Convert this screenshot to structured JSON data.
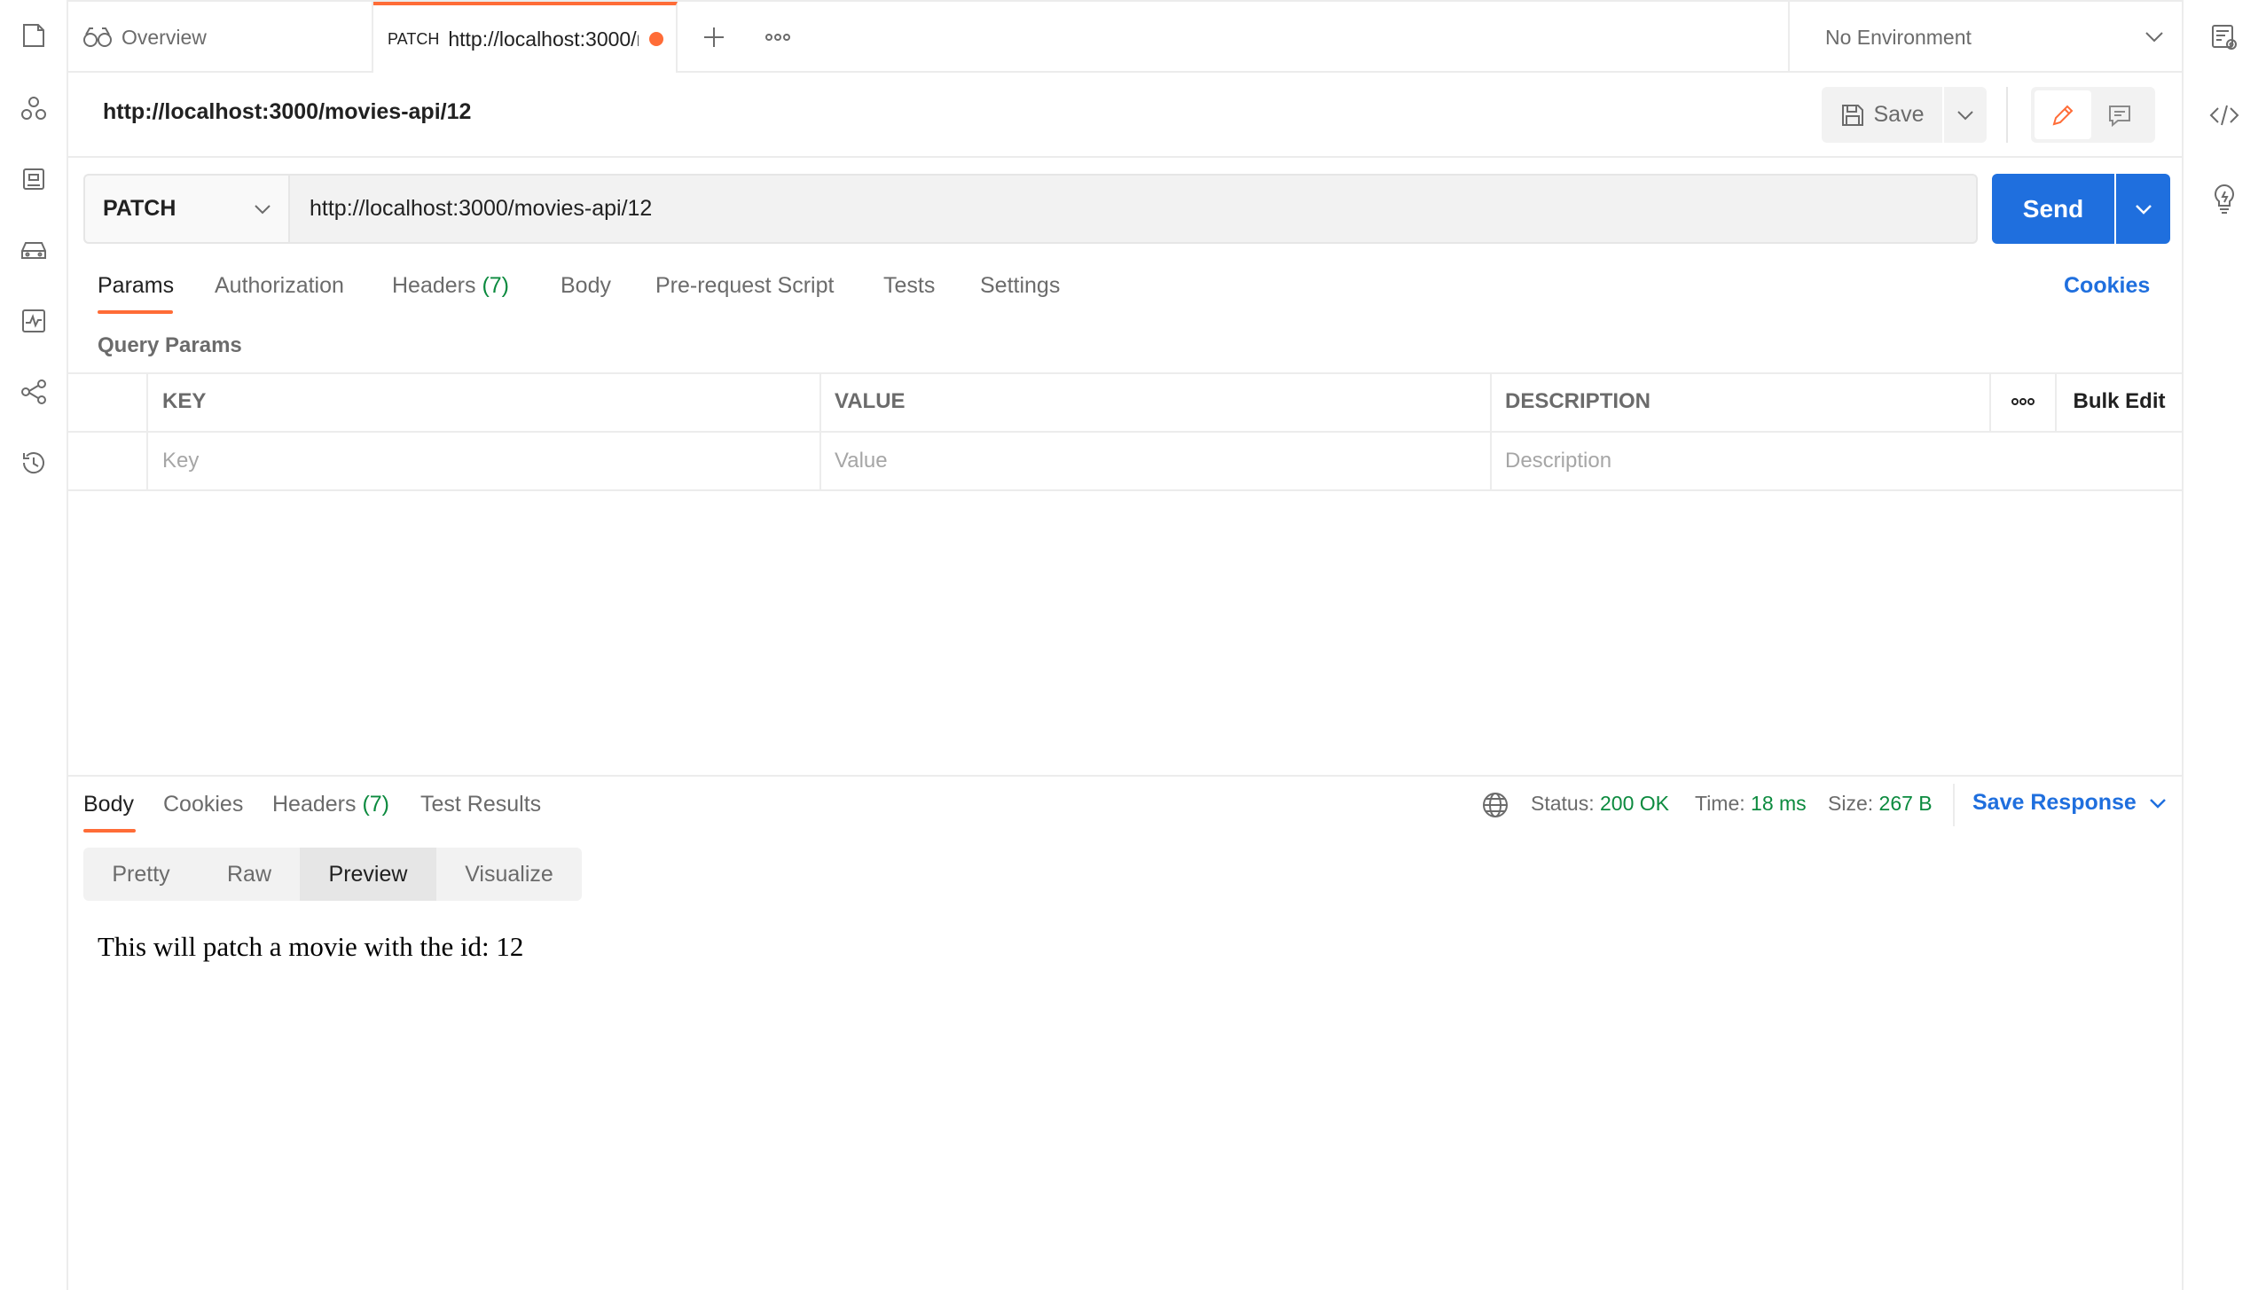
{
  "tabs": {
    "overview_label": "Overview",
    "active_method": "PATCH",
    "active_url": "http://localhost:3000/movies-api/12"
  },
  "environment": {
    "selected": "No Environment"
  },
  "request": {
    "title": "http://localhost:3000/movies-api/12",
    "method": "PATCH",
    "url": "http://localhost:3000/movies-api/12",
    "save_label": "Save",
    "send_label": "Send",
    "cookies_label": "Cookies",
    "tabs": [
      {
        "label": "Params"
      },
      {
        "label": "Authorization"
      },
      {
        "label": "Headers",
        "count": "(7)"
      },
      {
        "label": "Body"
      },
      {
        "label": "Pre-request Script"
      },
      {
        "label": "Tests"
      },
      {
        "label": "Settings"
      }
    ]
  },
  "query_params": {
    "section_label": "Query Params",
    "headers": {
      "key": "KEY",
      "value": "VALUE",
      "description": "DESCRIPTION",
      "bulk_edit": "Bulk Edit"
    },
    "placeholders": {
      "key": "Key",
      "value": "Value",
      "description": "Description"
    }
  },
  "response": {
    "tabs": [
      {
        "label": "Body"
      },
      {
        "label": "Cookies"
      },
      {
        "label": "Headers",
        "count": "(7)"
      },
      {
        "label": "Test Results"
      }
    ],
    "status_label": "Status:",
    "status_value": "200 OK",
    "time_label": "Time:",
    "time_value": "18 ms",
    "size_label": "Size:",
    "size_value": "267 B",
    "save_response_label": "Save Response",
    "view_modes": [
      "Pretty",
      "Raw",
      "Preview",
      "Visualize"
    ],
    "preview_text": "This will patch a movie with the id: 12"
  },
  "colors": {
    "accent": "#ff6c37",
    "primary": "#1f6fde",
    "success": "#0b8a3e"
  }
}
